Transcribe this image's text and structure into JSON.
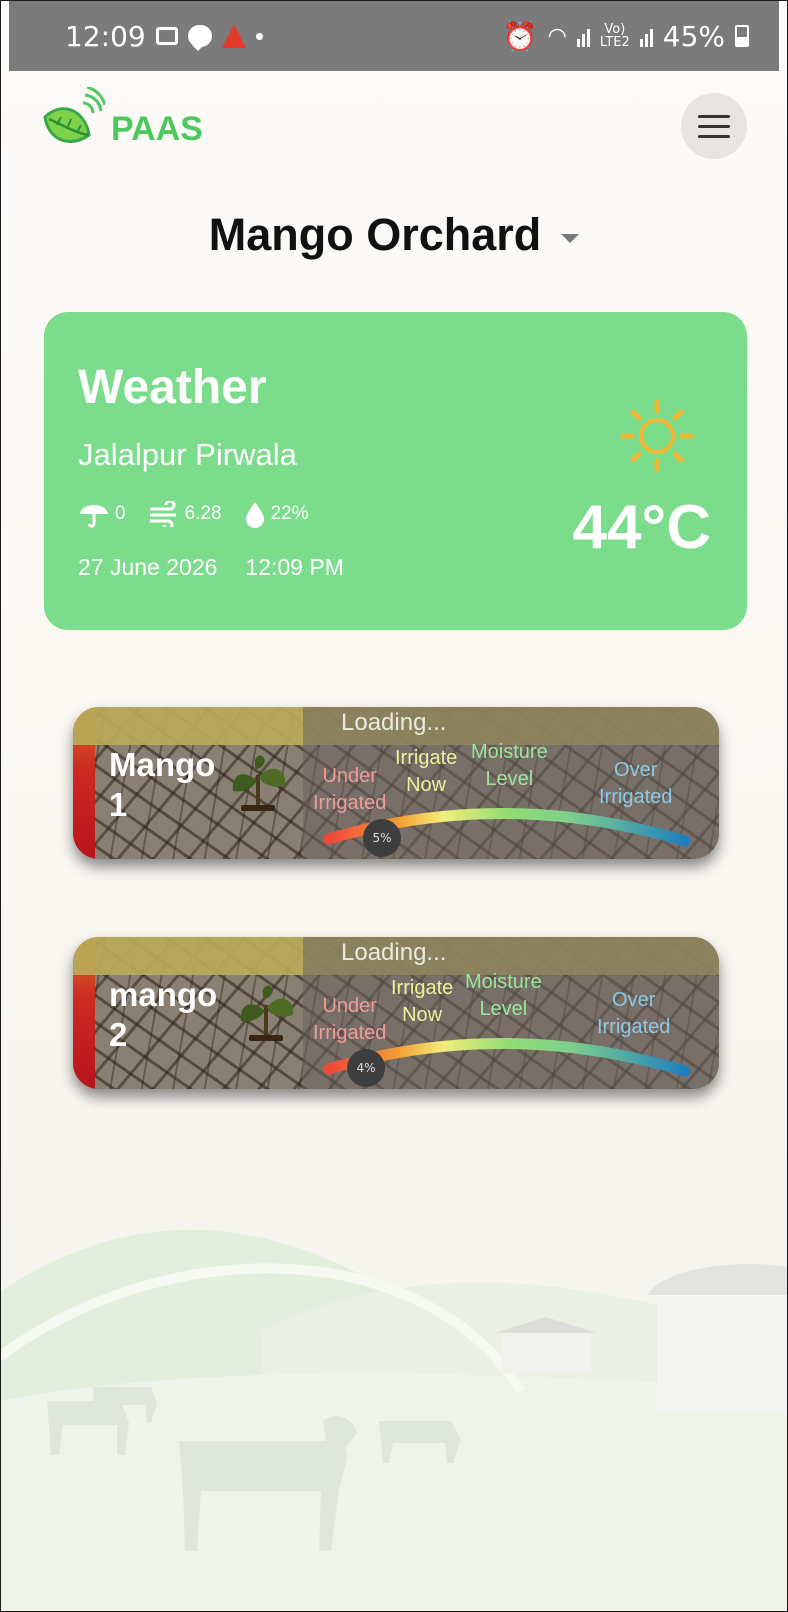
{
  "status_bar": {
    "time": "12:09",
    "volte_top": "Vo)",
    "volte_bottom": "LTE2",
    "battery": "45%"
  },
  "app": {
    "logo_text": "PAAS",
    "farm_name": "Mango Orchard"
  },
  "weather": {
    "title": "Weather",
    "location": "Jalalpur Pirwala",
    "rain": "0",
    "wind": "6.28",
    "humidity": "22%",
    "date": "27 June 2026",
    "time": "12:09 PM",
    "temperature": "44°C",
    "icon": "sun-icon",
    "accent_color": "#7bdc8c"
  },
  "sensors": [
    {
      "name_line1": "Mango",
      "name_line2": "1",
      "status": "Loading...",
      "moisture_percent": "5%",
      "labels": {
        "under": "Under",
        "under2": "Irrigated",
        "irrigate": "Irrigate",
        "irrigate2": "Now",
        "moisture": "Moisture",
        "moisture2": "Level",
        "over": "Over",
        "over2": "Irrigated"
      }
    },
    {
      "name_line1": "mango",
      "name_line2": "2",
      "status": "Loading...",
      "moisture_percent": "4%",
      "labels": {
        "under": "Under",
        "under2": "Irrigated",
        "irrigate": "Irrigate",
        "irrigate2": "Now",
        "moisture": "Moisture",
        "moisture2": "Level",
        "over": "Over",
        "over2": "Irrigated"
      }
    }
  ]
}
